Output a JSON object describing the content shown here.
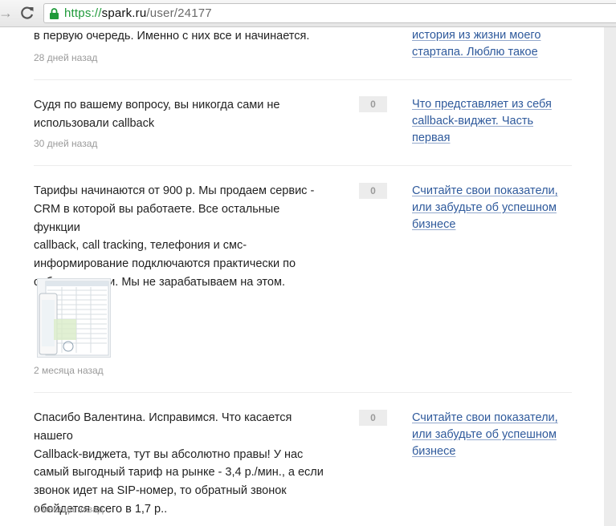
{
  "browser": {
    "url_scheme": "https://",
    "url_host": "spark.ru",
    "url_path": "/user/24177"
  },
  "comments": [
    {
      "text": "в первую очередь. Именно с них все и начинается.",
      "date": "28 дней назад",
      "link": "история из жизни моего\nстартапа. Люблю такое"
    },
    {
      "text": "Судя по вашему вопросу, вы никогда сами не\nиспользовали callback",
      "date": "30 дней назад",
      "rating": "0",
      "link": "Что представляет из себя\ncallback-виджет. Часть\nпервая"
    },
    {
      "text": "Тарифы начинаются от 900 р. Мы продаем сервис -\nCRM в которой вы работаете. Все остальные функции\ncallback, call tracking, телефония и смс-\nинформирование подключаются практически по\nсебестоимости. Мы не зарабатываем на этом.",
      "date": "2 месяца назад",
      "rating": "0",
      "link": "Считайте свои показатели,\nили забудьте об успешном\nбизнесе"
    },
    {
      "text": "Спасибо Валентина. Исправимся. Что касается нашего\nCallback-виджета, тут вы абсолютно правы! У нас\nсамый выгодный тариф на рынке - 3,4 р./мин., а если\nзвонок идет на SIP-номер, то обратный звонок\nобойдется всего в 1,7 р..",
      "date": "2 месяца назад",
      "rating": "0",
      "link": "Считайте свои показатели,\nили забудьте об успешном\nбизнесе"
    }
  ],
  "colors": {
    "link": "#2f5a9c",
    "date": "#9a9a9a",
    "secure_green": "#1f9a3a",
    "rating_bg": "#ececec"
  }
}
